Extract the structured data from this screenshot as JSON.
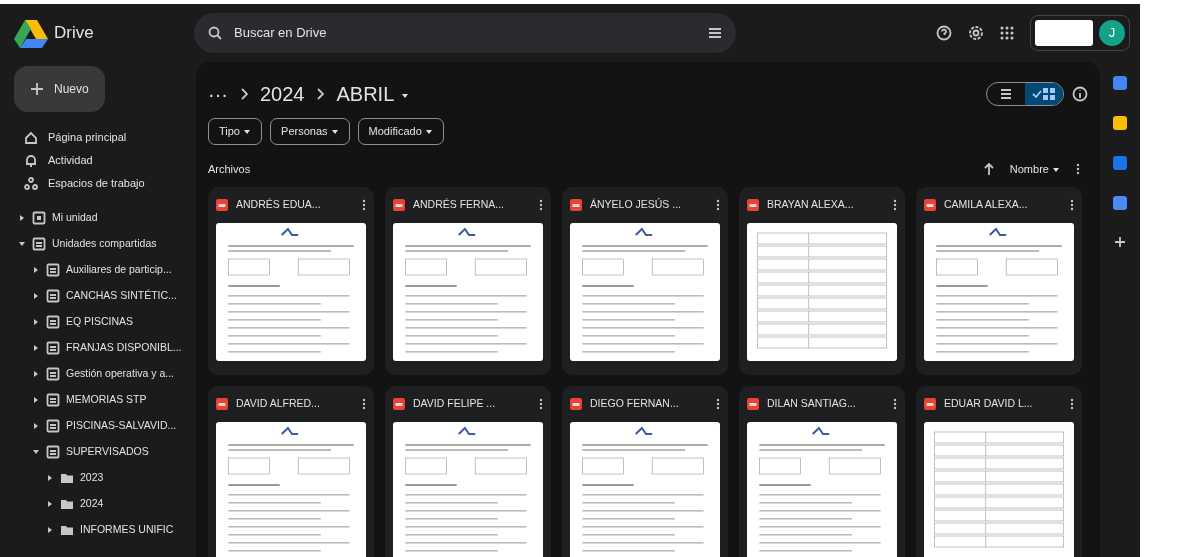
{
  "app": {
    "name": "Drive"
  },
  "search": {
    "placeholder": "Buscar en Drive"
  },
  "new_button": {
    "label": "Nuevo"
  },
  "nav": [
    {
      "label": "Página principal",
      "kind": "home"
    },
    {
      "label": "Actividad",
      "kind": "bell"
    },
    {
      "label": "Espacios de trabajo",
      "kind": "workspaces"
    }
  ],
  "tree": [
    {
      "label": "Mi unidad",
      "kind": "drive",
      "expanded": false
    },
    {
      "label": "Unidades compartidas",
      "kind": "shared",
      "expanded": true,
      "children": [
        {
          "label": "Auxiliares de particip...",
          "kind": "shared",
          "expanded": false
        },
        {
          "label": "CANCHAS SINTÉTIC...",
          "kind": "shared",
          "expanded": false
        },
        {
          "label": "EQ PISCINAS",
          "kind": "shared",
          "expanded": false
        },
        {
          "label": "FRANJAS DISPONIBL...",
          "kind": "shared",
          "expanded": false
        },
        {
          "label": "Gestión operativa y a...",
          "kind": "shared",
          "expanded": false
        },
        {
          "label": "MEMORIAS STP",
          "kind": "shared",
          "expanded": false
        },
        {
          "label": "PISCINAS-SALVAVID...",
          "kind": "shared",
          "expanded": false
        },
        {
          "label": "SUPERVISADOS",
          "kind": "shared",
          "expanded": true,
          "children": [
            {
              "label": "2023",
              "kind": "folder",
              "expanded": false
            },
            {
              "label": "2024",
              "kind": "folder",
              "expanded": false
            },
            {
              "label": "INFORMES UNIFIC",
              "kind": "folder",
              "expanded": false
            }
          ]
        }
      ]
    }
  ],
  "breadcrumb": [
    {
      "label": "···"
    },
    {
      "label": "2024"
    },
    {
      "label": "ABRIL"
    }
  ],
  "filters": [
    {
      "label": "Tipo"
    },
    {
      "label": "Personas"
    },
    {
      "label": "Modificado"
    }
  ],
  "view_toggle": [
    {
      "kind": "list",
      "selected": false
    },
    {
      "kind": "grid",
      "selected": true
    }
  ],
  "section_title": "Archivos",
  "sort": {
    "label": "Nombre"
  },
  "files": [
    {
      "name": "ANDRÉS EDUA...",
      "kind": "form"
    },
    {
      "name": "ANDRÉS FERNA...",
      "kind": "form"
    },
    {
      "name": "ÁNYELO JESÚS ...",
      "kind": "form"
    },
    {
      "name": "BRAYAN ALEXA...",
      "kind": "table"
    },
    {
      "name": "CAMILA ALEXA...",
      "kind": "form"
    },
    {
      "name": "DAVID ALFRED...",
      "kind": "form"
    },
    {
      "name": "DAVID FELIPE ...",
      "kind": "form"
    },
    {
      "name": "DIEGO FERNAN...",
      "kind": "form"
    },
    {
      "name": "DILAN SANTIAG...",
      "kind": "form"
    },
    {
      "name": "EDUAR DAVID L...",
      "kind": "table"
    }
  ],
  "avatar": {
    "initial": "J"
  },
  "side_apps": [
    {
      "color": "#4285f4"
    },
    {
      "color": "#fbbc04"
    },
    {
      "color": "#1a73e8"
    },
    {
      "color": "#4c8bf5"
    }
  ]
}
